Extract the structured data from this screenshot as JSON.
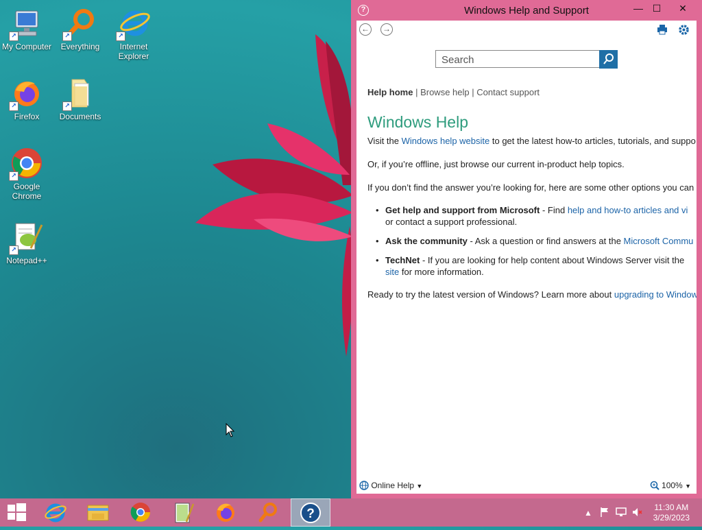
{
  "desktop": {
    "icons": [
      {
        "label": "My Computer"
      },
      {
        "label": "Everything"
      },
      {
        "label": "Internet Explorer"
      },
      {
        "label": "Firefox"
      },
      {
        "label": "Documents"
      },
      {
        "label": "Google Chrome"
      },
      {
        "label": "Notepad++"
      }
    ]
  },
  "window": {
    "title": "Windows Help and Support",
    "help_icon": "?",
    "controls": {
      "minimize": "—",
      "maximize": "☐",
      "close": "✕"
    },
    "toolbar": {
      "print_icon": "printer-icon",
      "settings_icon": "gear-icon"
    },
    "search": {
      "placeholder": "Search"
    },
    "nav_links": {
      "help_home": "Help home",
      "sep1": " | ",
      "browse_help": "Browse help",
      "sep2": " | ",
      "contact_support": "Contact support"
    },
    "content": {
      "heading": "Windows Help",
      "p1_pre": "Visit the ",
      "p1_link": "Windows help website",
      "p1_post": " to get the latest how-to articles, tutorials, and suppo",
      "p2": "Or, if you’re offline, just browse our current in-product help topics.",
      "p3": "If you don’t find the answer you’re looking for, here are some other options you can",
      "b1_bold": "Get help and support from Microsoft",
      "b1_text": " - Find ",
      "b1_link": "help and how-to articles and vi",
      "b1_line2": "or contact a support professional.",
      "b2_bold": "Ask the community",
      "b2_text": " - Ask a question or find answers at the ",
      "b2_link": "Microsoft Commu",
      "b3_bold": "TechNet",
      "b3_text": " - If you are looking for help content about Windows Server visit the",
      "b3_link2": "site",
      "b3_line2": " for more information.",
      "p4_pre": "Ready to try the latest version of Windows? Learn more about ",
      "p4_link": "upgrading to Window"
    },
    "status": {
      "online_help": "Online Help",
      "zoom": "100%"
    }
  },
  "taskbar": {
    "time": "11:30 AM",
    "date": "3/29/2023"
  }
}
